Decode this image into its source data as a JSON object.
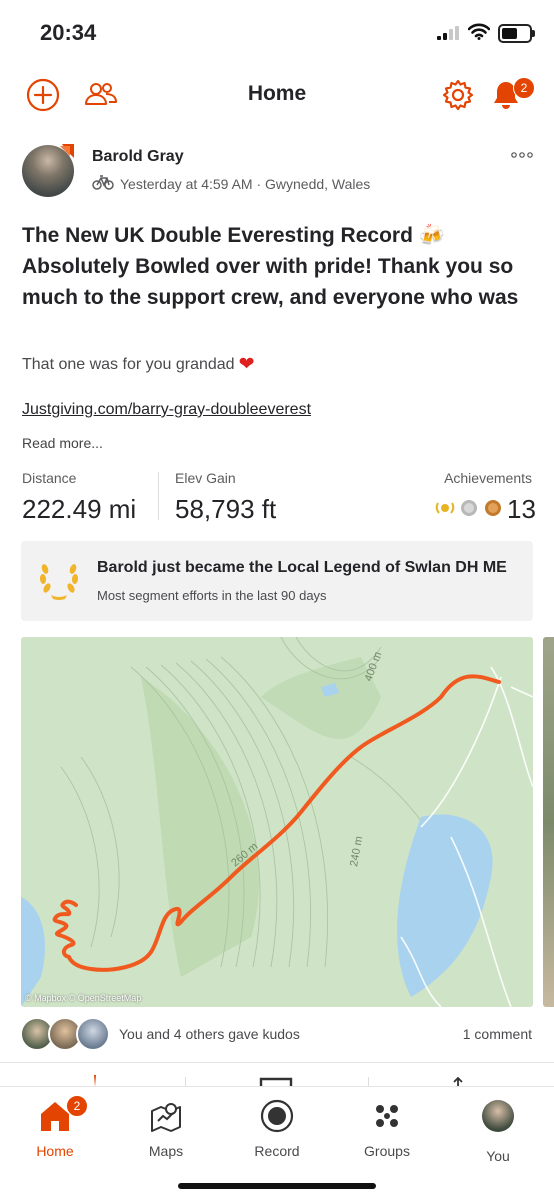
{
  "status_bar": {
    "time": "20:34"
  },
  "nav": {
    "title": "Home",
    "notification_count": "2"
  },
  "post": {
    "athlete": "Barold Gray",
    "meta": "Yesterday at 4:59 AM · Gwynedd, Wales",
    "headline": "The New UK Double Everesting Record 🍻 Absolutely Bowled over with pride! Thank you so much to the support crew, and everyone who was able to donate! Huge team effort which I’ll forev…",
    "body": "That one was for you grandad",
    "link": "Justgiving.com/barry-gray-doubleeverest",
    "read_more": "Read more...",
    "stats": {
      "distance_label": "Distance",
      "distance_value": "222.49 mi",
      "elev_label": "Elev Gain",
      "elev_value": "58,793 ft",
      "ach_label": "Achievements",
      "ach_count": "13"
    },
    "legend": {
      "title": "Barold just became the Local Legend of Swlan DH ME",
      "subtitle": "Most segment efforts in the last 90 days"
    },
    "map": {
      "attribution": "© Mapbox © OpenStreetMap",
      "contour_labels": [
        "400 m",
        "240 m",
        "260 m"
      ]
    },
    "kudos_text": "You and 4 others gave kudos",
    "comments": "1 comment"
  },
  "tabs": [
    {
      "label": "Home",
      "badge": "2"
    },
    {
      "label": "Maps"
    },
    {
      "label": "Record"
    },
    {
      "label": "Groups"
    },
    {
      "label": "You"
    }
  ],
  "colors": {
    "brand": "#e34402",
    "map_land": "#cfe3c6",
    "map_water": "#a8d2ee",
    "route": "#f05a1e"
  }
}
